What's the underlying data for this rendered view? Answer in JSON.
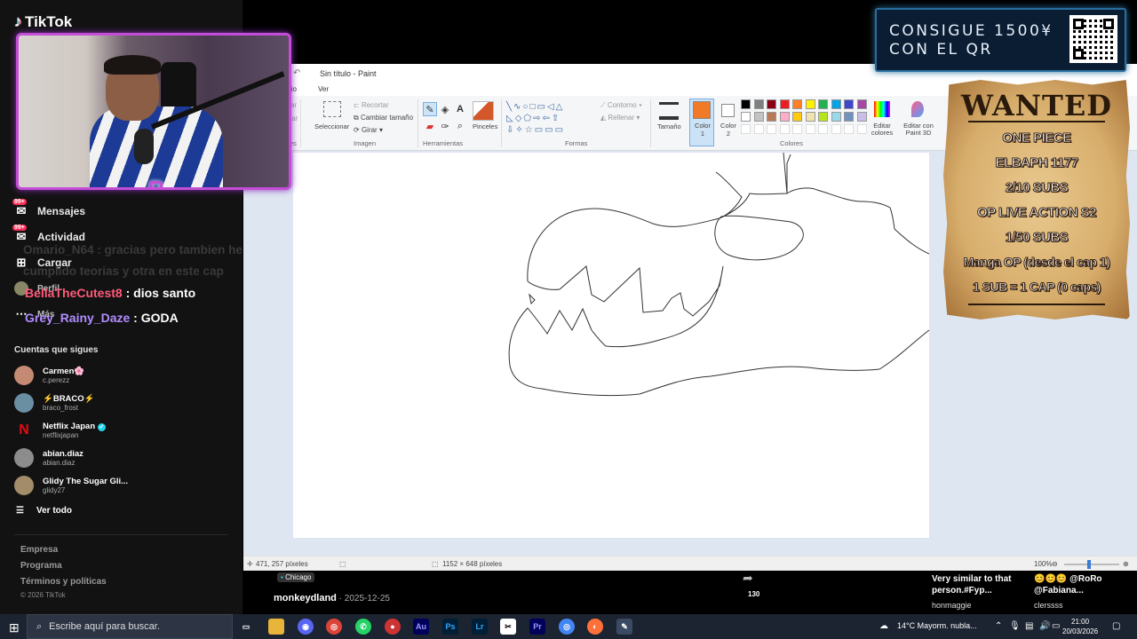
{
  "tiktok": {
    "logo": "TikTok",
    "nav": [
      {
        "label": "Mensajes",
        "badge": "99+"
      },
      {
        "label": "Actividad",
        "badge": "99+"
      },
      {
        "label": "Cargar"
      },
      {
        "label": "Perfil"
      },
      {
        "label": "Más"
      }
    ],
    "following_title": "Cuentas que sigues",
    "following": [
      {
        "name": "Carmen🌸",
        "handle": "c.perezz"
      },
      {
        "name": "⚡BRACO⚡",
        "handle": "braco_frost"
      },
      {
        "name": "Netflix Japan",
        "handle": "netflixjapan"
      },
      {
        "name": "abian.diaz",
        "handle": "abian.diaz"
      },
      {
        "name": "Glidy The Sugar Gli...",
        "handle": "glidy27"
      }
    ],
    "see_all": "Ver todo",
    "footer": [
      "Empresa",
      "Programa",
      "Términos y políticas"
    ],
    "copyright": "© 2026 TikTok"
  },
  "chat": {
    "faded": "Omario_N64 : gracias pero tambien he cumplido teorias y otra en este cap",
    "lines": [
      {
        "user": "BellaTheCutest8",
        "text": " : dios santo",
        "color": "#ff5a7a"
      },
      {
        "user": "Grey_Rainy_Daze",
        "text": " : GODA",
        "color": "#b18cff"
      }
    ]
  },
  "paint": {
    "title": "Sin título - Paint",
    "tabs": [
      "icio",
      "Ver"
    ],
    "ribbon": {
      "left_labels": [
        "rtar",
        "piar"
      ],
      "select": "Seleccionar",
      "crop": "Recortar",
      "resize": "Cambiar tamaño",
      "rotate": "Girar",
      "brushes": "Pinceles",
      "outline": "Contorno",
      "fill": "Rellenar",
      "size": "Tamaño",
      "color1": "Color 1",
      "color2": "Color 2",
      "edit_colors": "Editar colores",
      "paint3d": "Editar con Paint 3D",
      "groups": [
        "es",
        "Imagen",
        "Herramientas",
        "Formas",
        "Colores"
      ]
    },
    "colors": {
      "color1": "#f07a26",
      "palette_row1": [
        "#000000",
        "#7f7f7f",
        "#880015",
        "#ed1c24",
        "#ff7f27",
        "#fff200",
        "#22b14c",
        "#00a2e8",
        "#3f48cc",
        "#a349a4"
      ],
      "palette_row2": [
        "#ffffff",
        "#c3c3c3",
        "#b97a57",
        "#ffaec9",
        "#ffc90e",
        "#efe4b0",
        "#b5e61d",
        "#99d9ea",
        "#7092be",
        "#c8bfe7"
      ]
    },
    "status": {
      "cursor": "471, 257 píxeles",
      "size": "1152 × 648 píxeles",
      "zoom": "100%"
    }
  },
  "promo": {
    "line1": "CONSIGUE 1500¥",
    "line2": "CON EL QR"
  },
  "wanted": {
    "title": "WANTED",
    "lines": [
      "ONE PIECE",
      "ELBAPH 1177",
      "2/10 SUBS",
      "OP LIVE ACTION S2",
      "1/50 SUBS",
      "Manga OP (desde el cap 1)",
      "1 SUB = 1 CAP (0 caps)"
    ]
  },
  "video": {
    "location": "Chicago",
    "user": "monkeydland",
    "date": " · 2025-12-25",
    "count": "130",
    "similar": "Very similar to that person.#Fyp...",
    "similar_user": "honmaggie",
    "mention": "😊😊😊 @RoRo @Fabiana...",
    "mention_user": "clerssss"
  },
  "taskbar": {
    "search_placeholder": "Escribe aquí para buscar.",
    "apps": [
      "Au",
      "Ps",
      "Lr",
      "Pr"
    ],
    "weather": "14°C  Mayorm. nubla...",
    "time": "21:00",
    "date": "20/03/2026"
  }
}
